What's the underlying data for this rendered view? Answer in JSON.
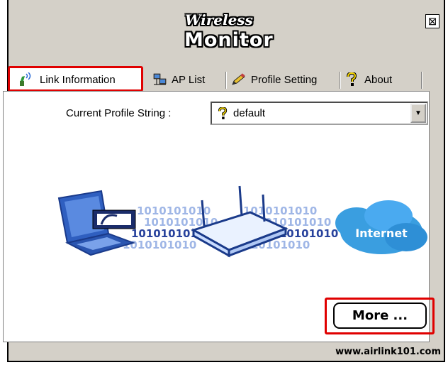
{
  "app": {
    "title_line1": "Wireless",
    "title_line2": "Monitor",
    "close_glyph": "⊠"
  },
  "tabs": [
    {
      "label": "Link Information",
      "icon": "antenna-icon",
      "active": true
    },
    {
      "label": "AP List",
      "icon": "network-computers-icon",
      "active": false
    },
    {
      "label": "Profile Setting",
      "icon": "pencil-icon",
      "active": false
    },
    {
      "label": "About",
      "icon": "question-mark-icon",
      "active": false
    }
  ],
  "profile": {
    "label": "Current Profile String :",
    "selected": "default",
    "selected_icon": "question-mark-icon"
  },
  "illustration": {
    "cloud_label": "Internet",
    "binary_text": "1010101010"
  },
  "more_button": {
    "label": "More ..."
  },
  "footer": {
    "url": "www.airlink101.com"
  },
  "colors": {
    "highlight": "#e00000",
    "window_bg": "#d4d0c8",
    "cloud": "#3a9ee0",
    "laptop": "#2f5fc0"
  }
}
